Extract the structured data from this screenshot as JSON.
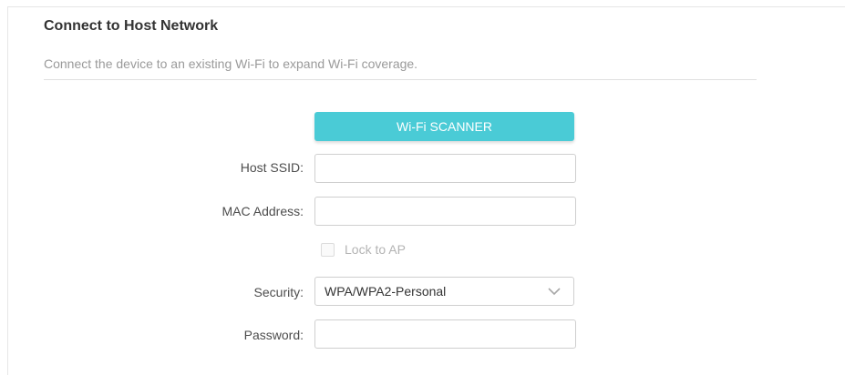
{
  "section": {
    "title": "Connect to Host Network",
    "description": "Connect the device to an existing Wi-Fi to expand Wi-Fi coverage."
  },
  "scanner": {
    "button_label": "Wi-Fi SCANNER"
  },
  "form": {
    "host_ssid": {
      "label": "Host SSID:",
      "value": ""
    },
    "mac_address": {
      "label": "MAC Address:",
      "value": ""
    },
    "lock_to_ap": {
      "label": "Lock to AP",
      "checked": false,
      "disabled": true
    },
    "security": {
      "label": "Security:",
      "selected": "WPA/WPA2-Personal",
      "icon": "chevron-down-icon"
    },
    "password": {
      "label": "Password:",
      "value": ""
    }
  },
  "colors": {
    "accent": "#4acbd6",
    "title_text": "#333333",
    "muted_text": "#9a9a9a"
  }
}
